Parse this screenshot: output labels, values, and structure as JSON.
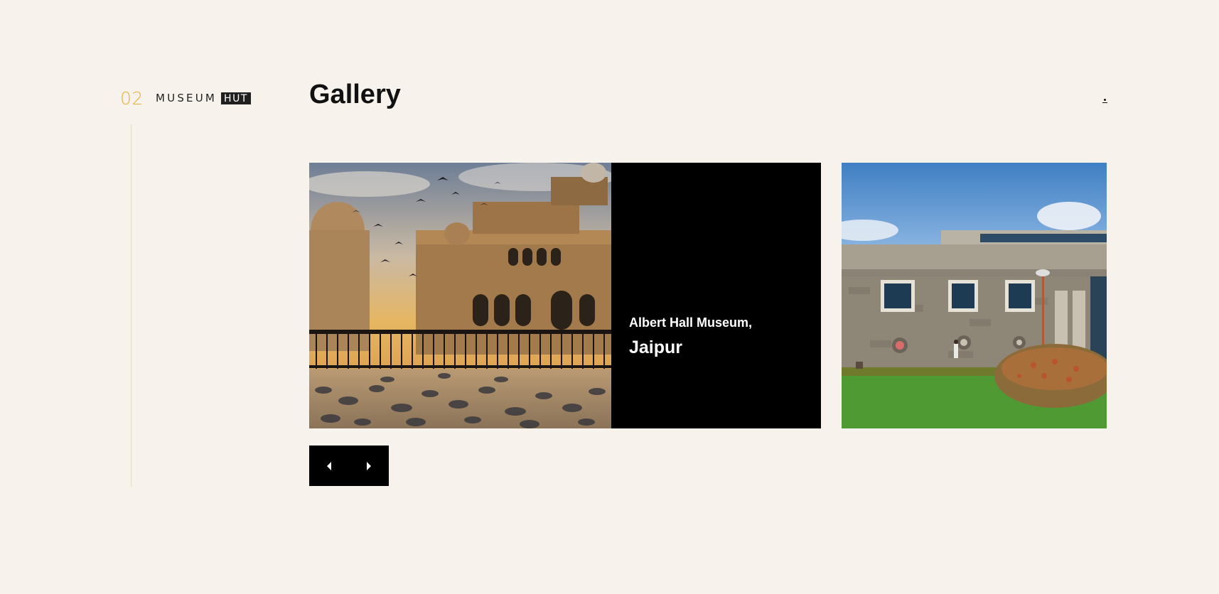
{
  "section": {
    "number": "02",
    "brand_main": "MUSEUM",
    "brand_tag": "HUT"
  },
  "header": {
    "title": "Gallery"
  },
  "slides": [
    {
      "name": "Albert Hall Museum,",
      "city": "Jaipur",
      "image": "albert-hall-museum-photo"
    },
    {
      "image": "stone-museum-building-photo"
    }
  ],
  "controls": {
    "prev_icon": "caret-left-icon",
    "next_icon": "caret-right-icon"
  },
  "colors": {
    "background": "#f7f3ec",
    "accent": "#e8b23a",
    "caption_bg": "#000000",
    "text": "#111111"
  }
}
